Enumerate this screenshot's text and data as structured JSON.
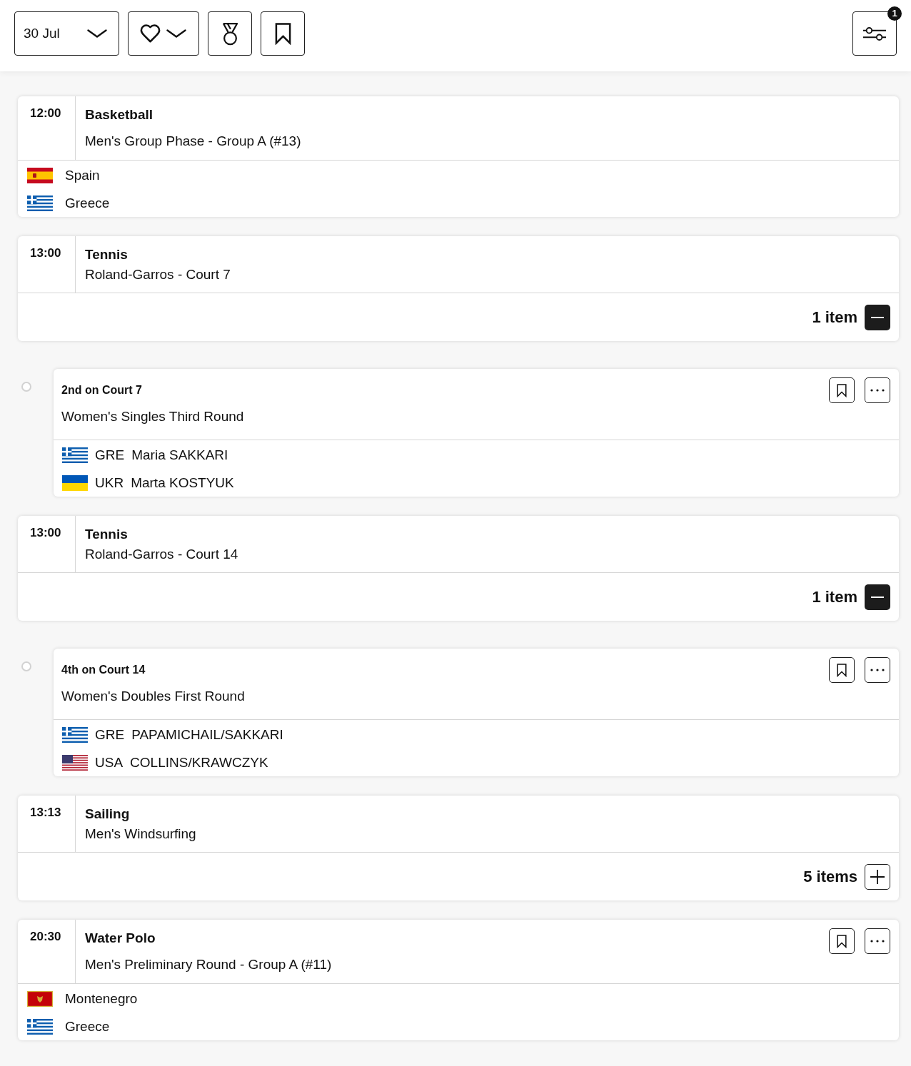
{
  "toolbar": {
    "date": "30 Jul",
    "filter_count": "1"
  },
  "events": [
    {
      "kind": "match",
      "time": "12:00",
      "sport": "Basketball",
      "title": "Men's Group Phase - Group A (#13)",
      "actions": false,
      "competitors": [
        {
          "kind": "spain",
          "name": "Spain"
        },
        {
          "kind": "greece",
          "name": "Greece"
        }
      ]
    },
    {
      "kind": "session",
      "time": "13:00",
      "sport": "Tennis",
      "title": "Roland-Garros - Court 7",
      "count": "1 item",
      "expanded": true,
      "children": [
        {
          "order": "2nd on Court 7",
          "title": "Women's Singles Third Round",
          "competitors": [
            {
              "kind": "greece",
              "code": "GRE",
              "name": "Maria SAKKARI"
            },
            {
              "kind": "ukraine",
              "code": "UKR",
              "name": "Marta KOSTYUK"
            }
          ]
        }
      ]
    },
    {
      "kind": "session",
      "time": "13:00",
      "sport": "Tennis",
      "title": "Roland-Garros - Court 14",
      "count": "1 item",
      "expanded": true,
      "children": [
        {
          "order": "4th on Court 14",
          "title": "Women's Doubles First Round",
          "competitors": [
            {
              "kind": "greece",
              "code": "GRE",
              "name": "PAPAMICHAIL/SAKKARI"
            },
            {
              "kind": "usa",
              "code": "USA",
              "name": "COLLINS/KRAWCZYK"
            }
          ]
        }
      ]
    },
    {
      "kind": "session",
      "time": "13:13",
      "sport": "Sailing",
      "title": "Men's Windsurfing",
      "count": "5 items",
      "expanded": false
    },
    {
      "kind": "match",
      "time": "20:30",
      "sport": "Water Polo",
      "title": "Men's Preliminary Round - Group A (#11)",
      "actions": true,
      "competitors": [
        {
          "kind": "montenegro",
          "name": "Montenegro"
        },
        {
          "kind": "greece",
          "name": "Greece"
        }
      ]
    }
  ]
}
